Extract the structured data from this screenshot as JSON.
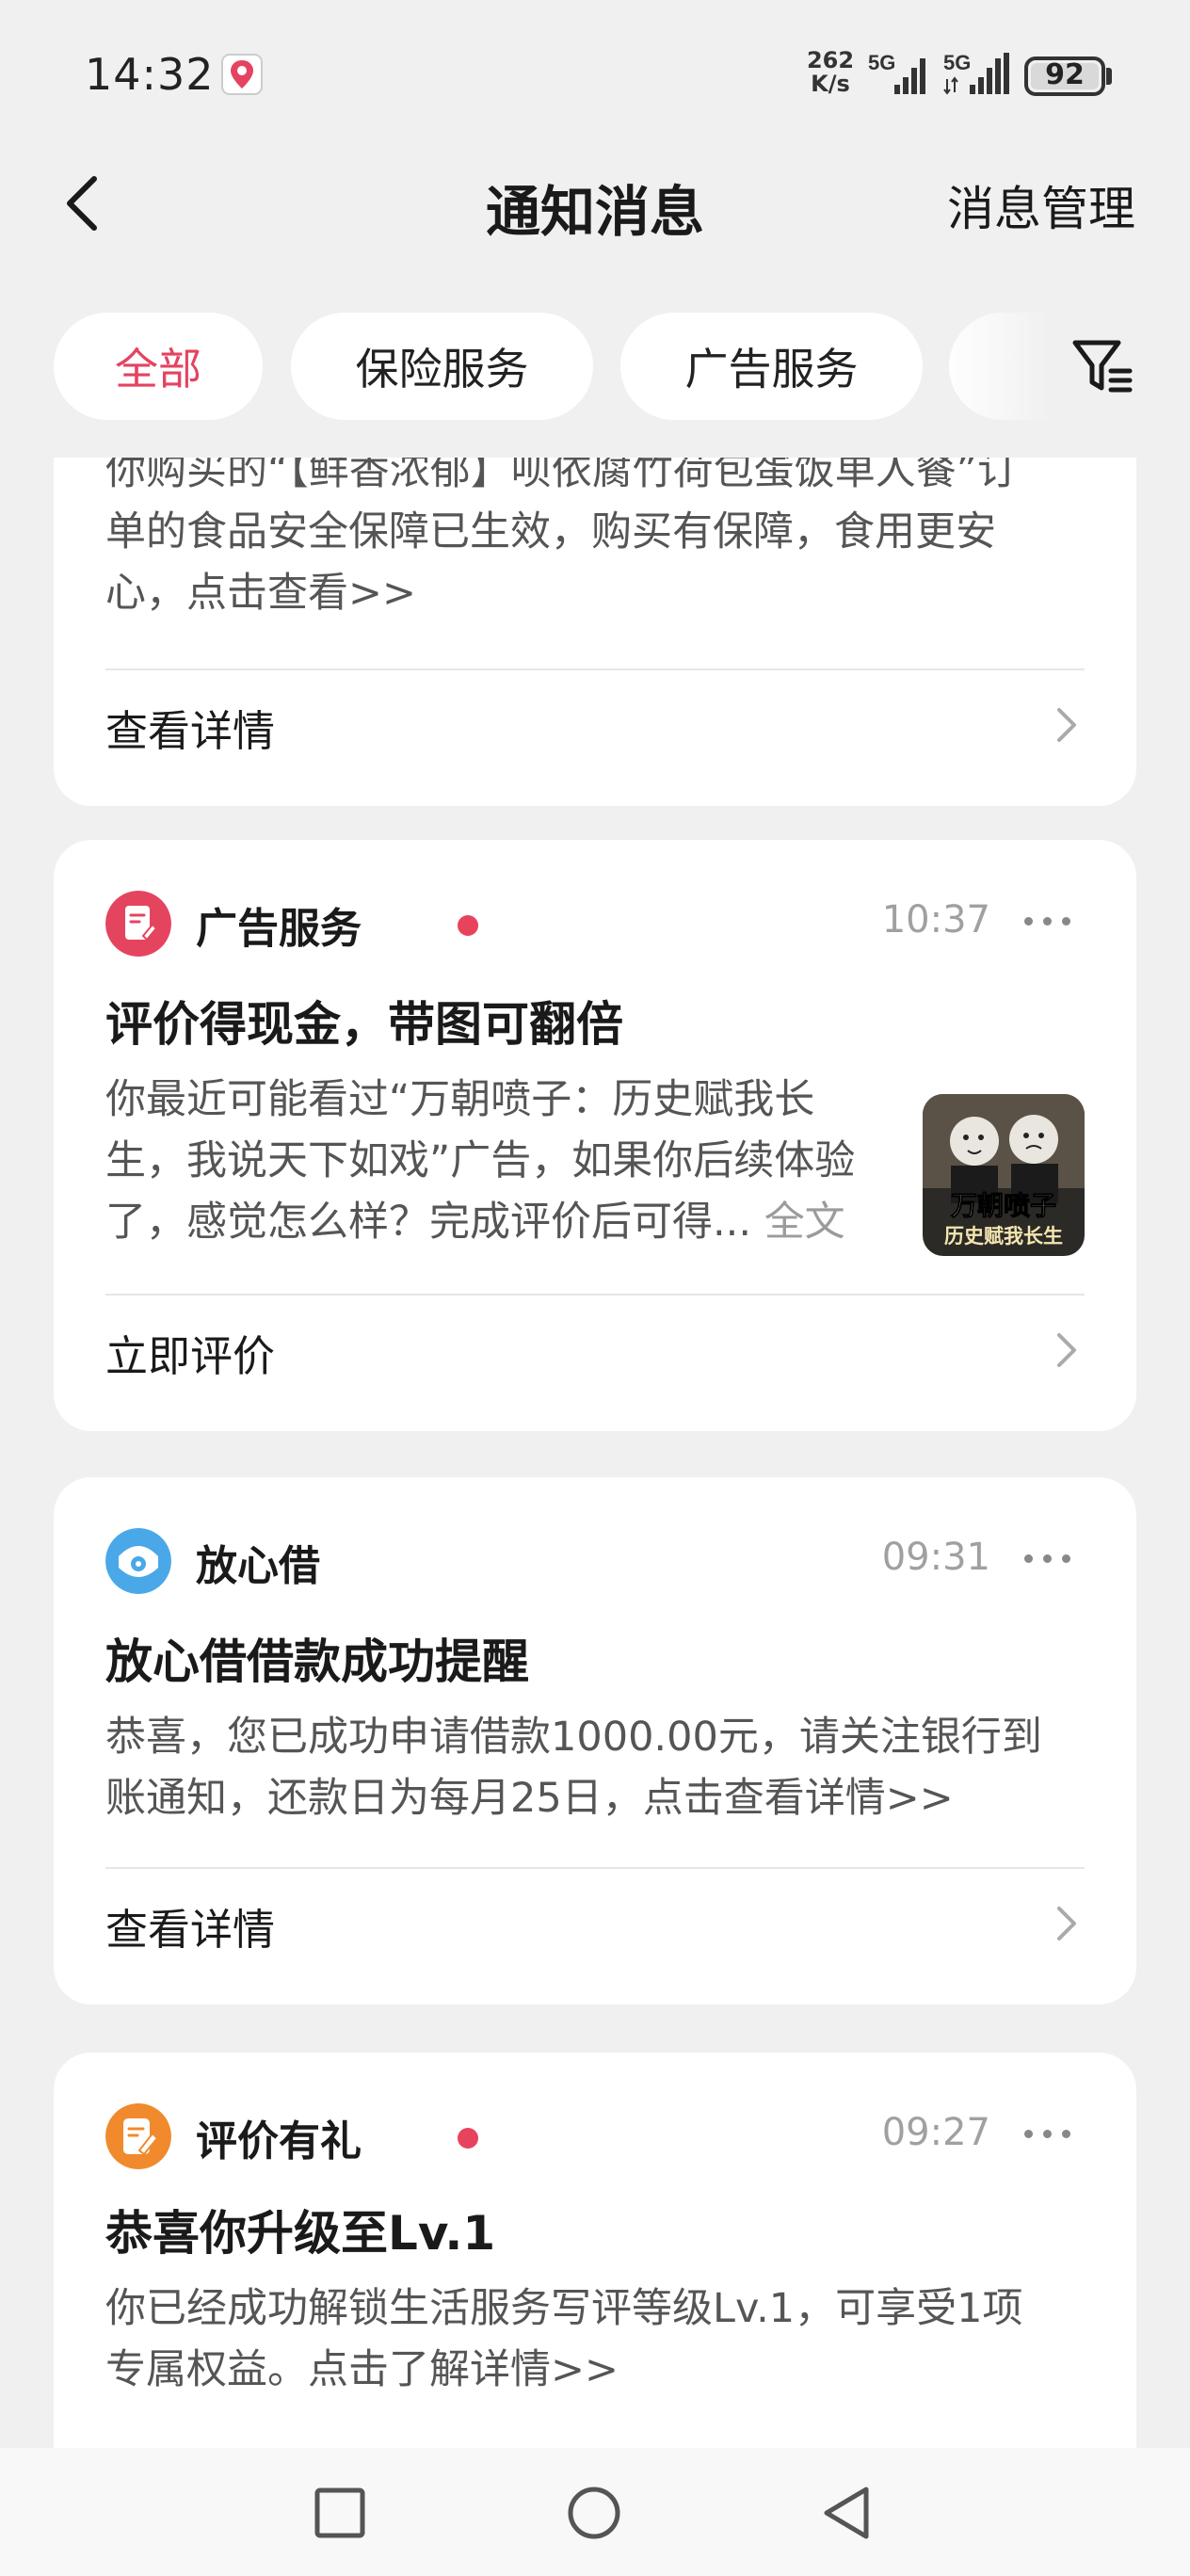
{
  "status_bar": {
    "time": "14:32",
    "net_speed_value": "262",
    "net_speed_unit": "K/s",
    "sim1": "5G",
    "sim2": "5G",
    "battery": "92"
  },
  "header": {
    "title": "通知消息",
    "manage_label": "消息管理"
  },
  "tabs": [
    {
      "label": "全部",
      "active": true
    },
    {
      "label": "保险服务",
      "active": false
    },
    {
      "label": "广告服务",
      "active": false
    }
  ],
  "colors": {
    "accent": "#e44361",
    "unread_dot": "#e8435d",
    "ad_icon": "#e5445f",
    "loan_icon": "#4aa8e8",
    "review_icon": "#f08a2c"
  },
  "cards": [
    {
      "body_lines": [
        "你购买的“【鲜香浓郁】呗依腐竹荷包蛋饭单人餐”订",
        "单的食品安全保障已生效，购买有保障，食用更安",
        "心，点击查看>>"
      ],
      "action": "查看详情"
    },
    {
      "source": "广告服务",
      "source_icon": "document-icon",
      "unread": true,
      "time": "10:37",
      "title": "评价得现金，带图可翻倍",
      "body_lines": [
        "你最近可能看过“万朝喷子：历史赋我长",
        "生，我说天下如戏”广告，如果你后续体验",
        "了，感觉怎么样？完成评价后可得... "
      ],
      "full_text_link": "全文",
      "thumbnail": {
        "line1": "万朝喷子",
        "line2": "历史赋我长生"
      },
      "action": "立即评价"
    },
    {
      "source": "放心借",
      "source_icon": "loan-icon",
      "unread": false,
      "time": "09:31",
      "title": "放心借借款成功提醒",
      "body_lines": [
        "恭喜，您已成功申请借款1000.00元，请关注银行到",
        "账通知，还款日为每月25日，点击查看详情>>"
      ],
      "action": "查看详情"
    },
    {
      "source": "评价有礼",
      "source_icon": "pencil-icon",
      "unread": true,
      "time": "09:27",
      "title": "恭喜你升级至Lv.1",
      "body_lines": [
        "你已经成功解锁生活服务写评等级Lv.1，可享受1项",
        "专属权益。点击了解详情>>"
      ]
    }
  ]
}
